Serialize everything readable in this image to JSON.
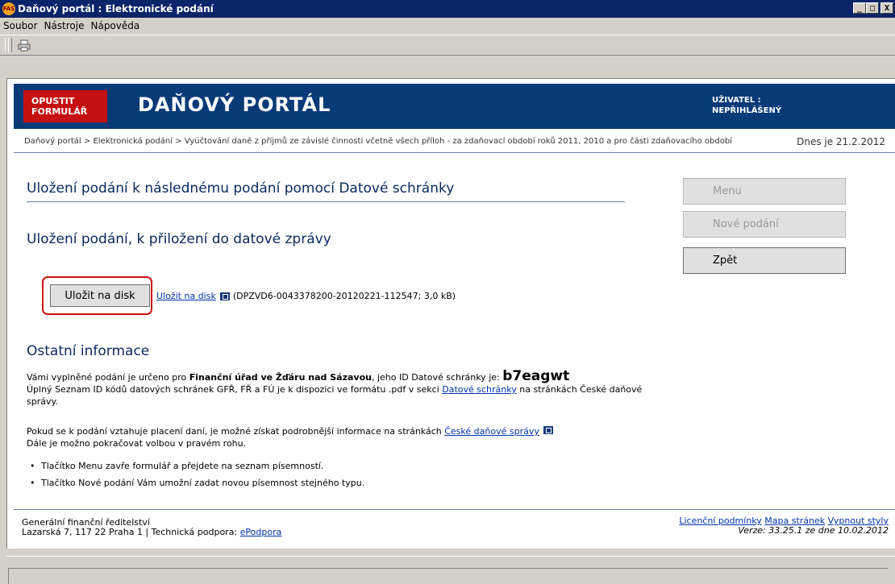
{
  "window": {
    "title": "Daňový portál : Elektronické podání",
    "app_icon_text": "FAS",
    "min_label": "_",
    "max_label": "□",
    "close_label": "X"
  },
  "menu": {
    "items": [
      "Soubor",
      "Nástroje",
      "Nápověda"
    ]
  },
  "header": {
    "leave_line1": "OPUSTIT",
    "leave_line2": "FORMULÁŘ",
    "portal_title": "DAŇOVÝ PORTÁL",
    "user_label": "UŽIVATEL :",
    "user_value": "NEPŘIHLÁŠENÝ"
  },
  "breadcrumb": {
    "text": "Daňový portál > Elektronická podání > Vyúčtování daně z příjmů ze závislé činnosti včetně všech příloh - za zdaňovací období roků 2011, 2010 a pro části zdaňovacího období",
    "date": "Dnes je 21.2.2012"
  },
  "main": {
    "heading": "Uložení podání k následnému podání pomocí Datové schránky",
    "subheading": "Uložení podání, k přiložení do datové zprávy",
    "save_button": "Uložit na disk",
    "save_link": "Uložit na disk",
    "file_info": "(DPZVD6-0043378200-20120221-112547; 3,0 kB)",
    "other_heading": "Ostatní informace",
    "p1_a": "Vámi vyplněné podání je určeno pro ",
    "p1_office": "Finanční úřad ve Žďáru nad Sázavou",
    "p1_b": ", jeho ID Datové schránky je: ",
    "p1_id": "b7eagwt",
    "p1_c": "Úplný Seznam ID kódů datových schránek GFŘ, FŘ a FÚ je k dispozici ve formátu .pdf v sekci ",
    "p1_link": "Datové schránky",
    "p1_d": " na stránkách České daňové správy.",
    "p2_a": "Pokud se k podání vztahuje placení daní, je možné získat podrobnější informace na stránkách ",
    "p2_link": "České daňové správy",
    "p2_b": "Dále je možno pokračovat volbou v pravém rohu.",
    "bullets": [
      "Tlačítko Menu zavře formulář a přejdete na seznam písemností.",
      "Tlačítko Nové podání Vám umožní zadat novou písemnost stejného typu."
    ]
  },
  "nav": {
    "menu": "Menu",
    "new": "Nové podání",
    "back": "Zpět"
  },
  "footer": {
    "org": "Generální finanční ředitelství",
    "address": "Lazarská 7, 117 22 Praha 1 | Technická podpora: ",
    "support_link": "ePodpora",
    "license": "Licenční podmínky",
    "sitemap": "Mapa stránek",
    "styles": "Vypnout styly",
    "version": "Verze: 33.25.1 ze dne 10.02.2012"
  }
}
